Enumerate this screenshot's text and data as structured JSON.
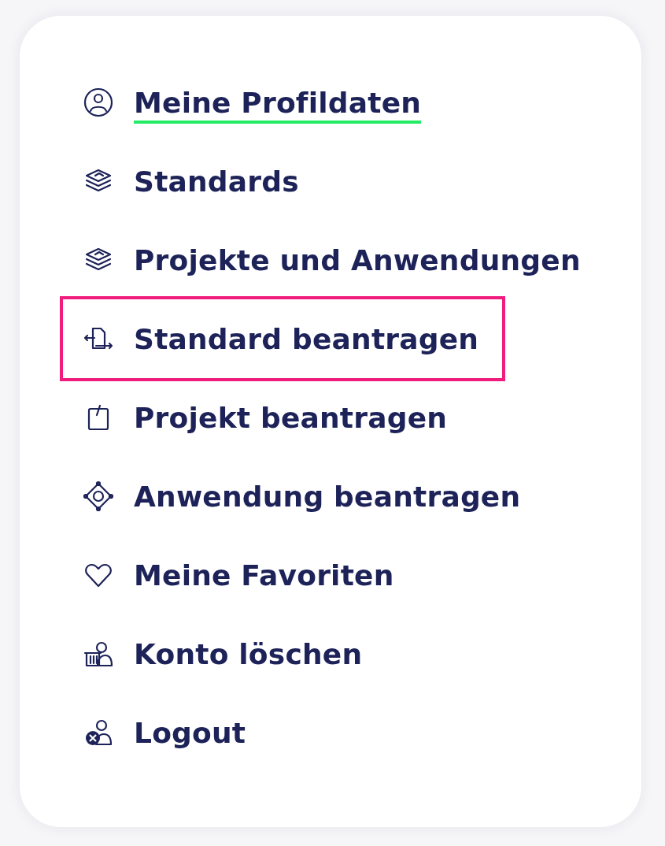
{
  "menu": {
    "items": [
      {
        "label": "Meine Profildaten",
        "kind": "profile",
        "selected": true,
        "highlighted": false
      },
      {
        "label": "Standards",
        "kind": "stack",
        "selected": false,
        "highlighted": false
      },
      {
        "label": "Projekte und Anwendungen",
        "kind": "stack",
        "selected": false,
        "highlighted": false
      },
      {
        "label": "Standard beantragen",
        "kind": "document-arrows",
        "selected": false,
        "highlighted": true
      },
      {
        "label": "Projekt beantragen",
        "kind": "clipboard",
        "selected": false,
        "highlighted": false
      },
      {
        "label": "Anwendung beantragen",
        "kind": "diamond",
        "selected": false,
        "highlighted": false
      },
      {
        "label": "Meine Favoriten",
        "kind": "heart",
        "selected": false,
        "highlighted": false
      },
      {
        "label": "Konto löschen",
        "kind": "user-trash",
        "selected": false,
        "highlighted": false
      },
      {
        "label": "Logout",
        "kind": "user-x",
        "selected": false,
        "highlighted": false
      }
    ]
  }
}
